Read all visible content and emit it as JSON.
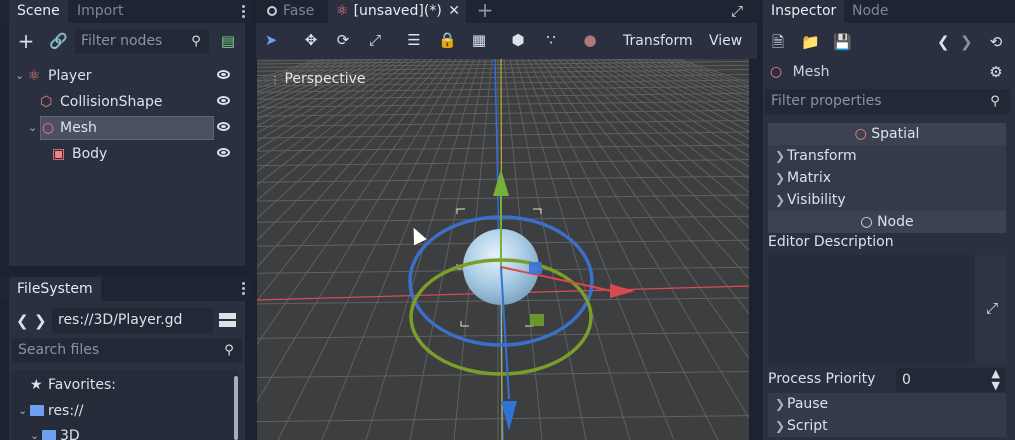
{
  "scene_dock": {
    "tabs": [
      "Scene",
      "Import"
    ],
    "filter_placeholder": "Filter nodes",
    "tree": [
      {
        "label": "Player",
        "icon": "spatial-node-icon",
        "color": "#fc7f7f"
      },
      {
        "label": "CollisionShape",
        "icon": "collision-shape-icon",
        "color": "#fc7f7f"
      },
      {
        "label": "Mesh",
        "icon": "mesh-instance-icon",
        "color": "#fc7f7f"
      },
      {
        "label": "Body",
        "icon": "mesh-body-icon",
        "color": "#fc7f7f"
      }
    ]
  },
  "filesystem_dock": {
    "tab": "FileSystem",
    "path": "res://3D/Player.gd",
    "search_placeholder": "Search files",
    "items": [
      {
        "label": "Favorites:",
        "icon": "star-icon"
      },
      {
        "label": "res://",
        "icon": "folder-icon"
      },
      {
        "label": "3D",
        "icon": "folder-icon"
      }
    ]
  },
  "editor_tabs": [
    {
      "label": "Fase",
      "active": false
    },
    {
      "label": "[unsaved](*)",
      "active": true
    }
  ],
  "toolbar": {
    "transform_menu": "Transform",
    "view_menu": "View"
  },
  "viewport": {
    "perspective_label": "Perspective"
  },
  "inspector": {
    "tabs": [
      "Inspector",
      "Node"
    ],
    "object_name": "Mesh",
    "filter_placeholder": "Filter properties",
    "sections": [
      {
        "header": "Spatial"
      },
      {
        "header": "Node"
      }
    ],
    "spatial_props": [
      "Transform",
      "Matrix",
      "Visibility"
    ],
    "editor_description_label": "Editor Description",
    "process_priority_label": "Process Priority",
    "process_priority_value": "0",
    "node_props": [
      "Pause",
      "Script"
    ]
  },
  "colors": {
    "accent": "#6e9ff0",
    "node_red": "#fc7f7f",
    "selection": "#4a5163"
  }
}
